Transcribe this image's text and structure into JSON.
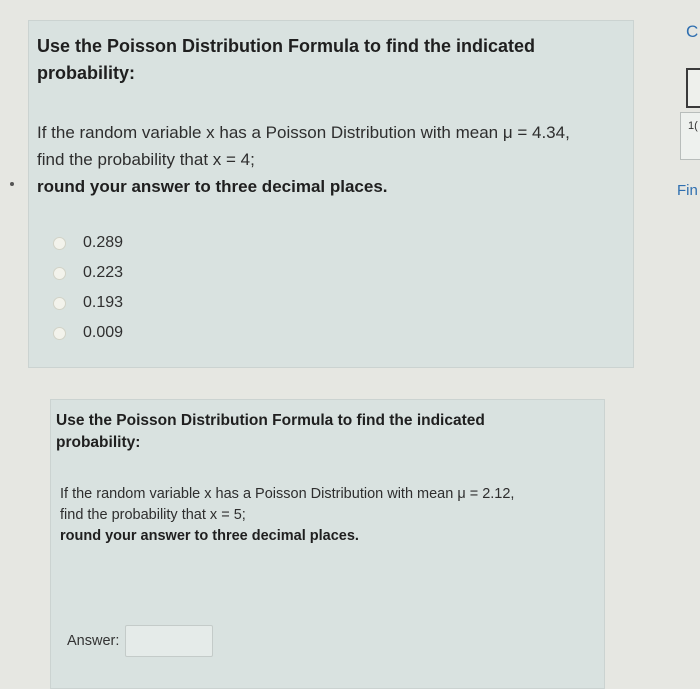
{
  "question1": {
    "title": "Use the Poisson Distribution Formula to find the indicated probability:",
    "line1": "If the random variable x has a Poisson Distribution with mean μ = 4.34,",
    "line2": "find the probability that x = 4;",
    "line3": "round your answer to three decimal places.",
    "options": [
      "0.289",
      "0.223",
      "0.193",
      "0.009"
    ]
  },
  "question2": {
    "title": "Use the Poisson Distribution Formula to find the indicated probability:",
    "line1": "If the random variable x has a Poisson Distribution with mean μ = 2.12,",
    "line2": "find the probability that x = 5;",
    "line3": "round your answer to three decimal places.",
    "answer_label": "Answer:",
    "answer_value": ""
  },
  "right_panel": {
    "top_letter": "C",
    "number": "1(",
    "fin_label": "Fin"
  }
}
